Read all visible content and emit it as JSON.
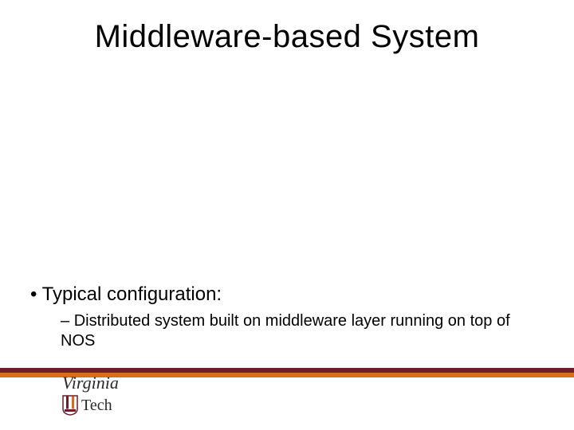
{
  "slide": {
    "title": "Middleware-based System",
    "bullets": {
      "item1": "Typical configuration:",
      "sub1": "Distributed system built on middleware layer running on top of NOS"
    }
  },
  "footer": {
    "logo_top": "Virginia",
    "logo_bottom": "Tech"
  },
  "colors": {
    "maroon": "#6b1f2a",
    "orange": "#d96d1a"
  }
}
